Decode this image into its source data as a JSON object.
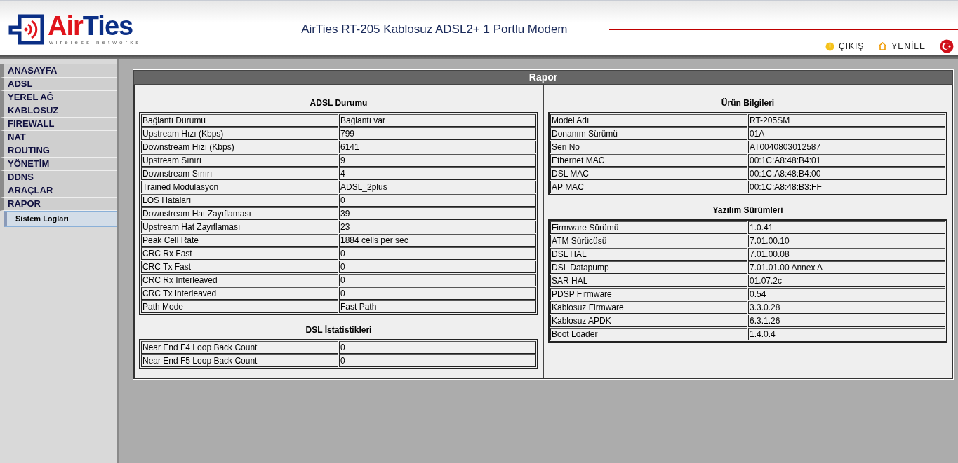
{
  "header": {
    "logo_brand": "AirTies",
    "logo_tagline": "wireless networks",
    "title": "AirTies RT-205 Kablosuz ADSL2+ 1 Portlu Modem",
    "links": [
      {
        "label": "ÇIKIŞ",
        "kind": "logout"
      },
      {
        "label": "YENİLE",
        "kind": "home"
      },
      {
        "kind": "flag"
      }
    ]
  },
  "sidebar": {
    "items": [
      {
        "label": "ANASAYFA"
      },
      {
        "label": "ADSL"
      },
      {
        "label": "YEREL AĞ"
      },
      {
        "label": "KABLOSUZ"
      },
      {
        "label": "FIREWALL"
      },
      {
        "label": "NAT"
      },
      {
        "label": "ROUTING"
      },
      {
        "label": "YÖNETİM"
      },
      {
        "label": "DDNS"
      },
      {
        "label": "ARAÇLAR"
      },
      {
        "label": "RAPOR",
        "children": [
          {
            "label": "Sistem Logları",
            "selected": true
          }
        ]
      }
    ]
  },
  "panel": {
    "title": "Rapor",
    "left": [
      {
        "heading": "ADSL Durumu",
        "rows": [
          [
            "Bağlantı Durumu",
            "Bağlantı var"
          ],
          [
            "Upstream Hızı (Kbps)",
            "799"
          ],
          [
            "Downstream Hızı (Kbps)",
            "6141"
          ],
          [
            "Upstream Sınırı",
            "9"
          ],
          [
            "Downstream Sınırı",
            "4"
          ],
          [
            "Trained Modulasyon",
            "ADSL_2plus"
          ],
          [
            "LOS Hataları",
            "0"
          ],
          [
            "Downstream Hat Zayıflaması",
            "39"
          ],
          [
            "Upstream Hat Zayıflaması",
            "23"
          ],
          [
            "Peak Cell Rate",
            "1884 cells per sec"
          ],
          [
            "CRC Rx Fast",
            "0"
          ],
          [
            "CRC Tx Fast",
            "0"
          ],
          [
            "CRC Rx Interleaved",
            "0"
          ],
          [
            "CRC Tx Interleaved",
            "0"
          ],
          [
            "Path Mode",
            "Fast Path"
          ]
        ]
      },
      {
        "heading": "DSL İstatistikleri",
        "rows": [
          [
            "Near End F4 Loop Back Count",
            "0"
          ],
          [
            "Near End F5 Loop Back Count",
            "0"
          ]
        ]
      }
    ],
    "right": [
      {
        "heading": "Ürün Bilgileri",
        "rows": [
          [
            "Model Adı",
            "RT-205SM"
          ],
          [
            "Donanım Sürümü",
            "01A"
          ],
          [
            "Seri No",
            "AT0040803012587"
          ],
          [
            "Ethernet MAC",
            "00:1C:A8:48:B4:01"
          ],
          [
            "DSL MAC",
            "00:1C:A8:48:B4:00"
          ],
          [
            "AP MAC",
            "00:1C:A8:48:B3:FF"
          ]
        ]
      },
      {
        "heading": "Yazılım Sürümleri",
        "rows": [
          [
            "Firmware Sürümü",
            "1.0.41"
          ],
          [
            "ATM Sürücüsü",
            "7.01.00.10"
          ],
          [
            "DSL HAL",
            "7.01.00.08"
          ],
          [
            "DSL Datapump",
            "7.01.01.00 Annex A"
          ],
          [
            "SAR HAL",
            "01.07.2c"
          ],
          [
            "PDSP Firmware",
            "0.54"
          ],
          [
            "Kablosuz Firmware",
            "3.3.0.28"
          ],
          [
            "Kablosuz APDK",
            "6.3.1.26"
          ],
          [
            "Boot Loader",
            "1.4.0.4"
          ]
        ]
      }
    ]
  }
}
